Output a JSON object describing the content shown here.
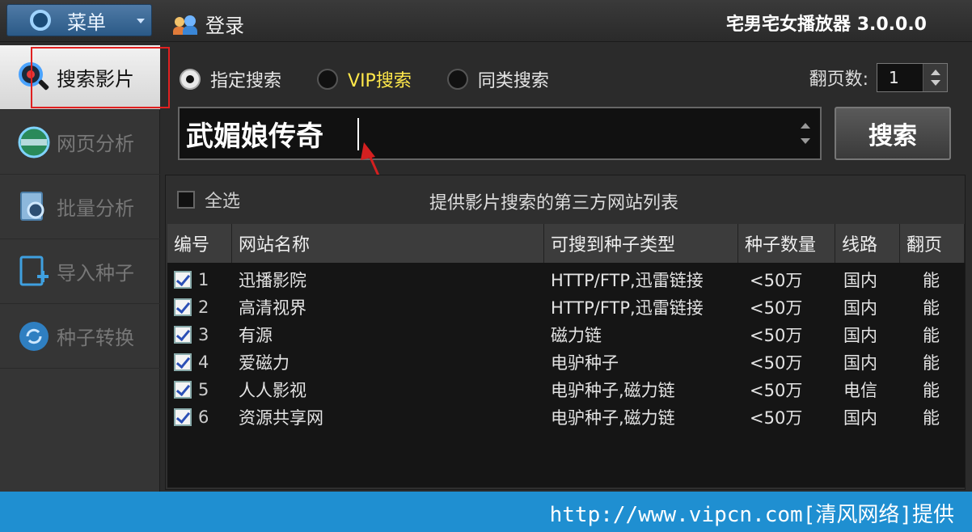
{
  "topbar": {
    "menu_label": "菜单",
    "login_label": "登录",
    "app_title": "宅男宅女播放器 3.0.0.0"
  },
  "sidebar": {
    "items": [
      {
        "label": "搜索影片",
        "icon": "search-movie-icon",
        "active": true
      },
      {
        "label": "网页分析",
        "icon": "web-analysis-icon",
        "active": false
      },
      {
        "label": "批量分析",
        "icon": "batch-analysis-icon",
        "active": false
      },
      {
        "label": "导入种子",
        "icon": "import-torrent-icon",
        "active": false
      },
      {
        "label": "种子转换",
        "icon": "torrent-convert-icon",
        "active": false
      }
    ]
  },
  "search": {
    "modes": [
      {
        "label": "指定搜索",
        "selected": true
      },
      {
        "label": "VIP搜索",
        "selected": false
      },
      {
        "label": "同类搜索",
        "selected": false
      }
    ],
    "pages_label": "翻页数:",
    "pages_value": "1",
    "query": "武媚娘传奇",
    "button_label": "搜索"
  },
  "sites": {
    "select_all_label": "全选",
    "title": "提供影片搜索的第三方网站列表",
    "columns": [
      "编号",
      "网站名称",
      "可搜到种子类型",
      "种子数量",
      "线路",
      "翻页"
    ],
    "rows": [
      {
        "id": "1",
        "name": "迅播影院",
        "type": "HTTP/FTP,迅雷链接",
        "count": "<50万",
        "line": "国内",
        "paging": "能"
      },
      {
        "id": "2",
        "name": "高清视界",
        "type": "HTTP/FTP,迅雷链接",
        "count": "<50万",
        "line": "国内",
        "paging": "能"
      },
      {
        "id": "3",
        "name": "有源",
        "type": "磁力链",
        "count": "<50万",
        "line": "国内",
        "paging": "能"
      },
      {
        "id": "4",
        "name": "爱磁力",
        "type": "电驴种子",
        "count": "<50万",
        "line": "国内",
        "paging": "能"
      },
      {
        "id": "5",
        "name": "人人影视",
        "type": "电驴种子,磁力链",
        "count": "<50万",
        "line": "电信",
        "paging": "能"
      },
      {
        "id": "6",
        "name": "资源共享网",
        "type": "电驴种子,磁力链",
        "count": "<50万",
        "line": "国内",
        "paging": "能"
      }
    ]
  },
  "footer": {
    "text": "http://www.vipcn.com[清风网络]提供"
  },
  "colors": {
    "accent": "#1f8fd1",
    "vip": "#ffe84a",
    "highlight": "#e02020"
  }
}
